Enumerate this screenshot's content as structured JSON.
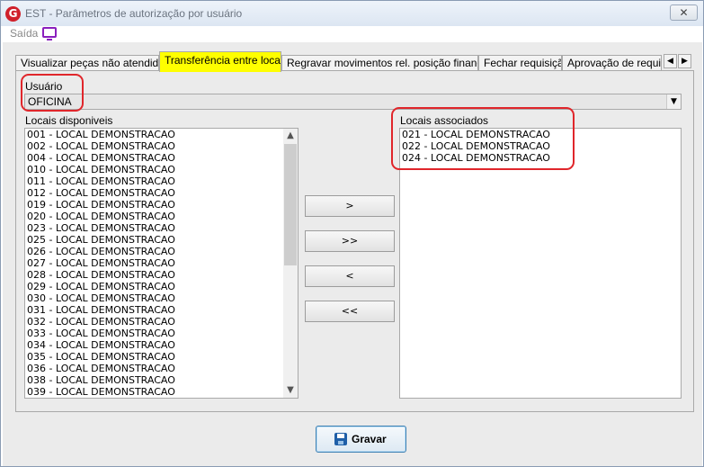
{
  "window": {
    "app_icon_letter": "G",
    "title": "EST - Parâmetros de autorização por usuário",
    "close_glyph": "✕"
  },
  "menu": {
    "saida_label": "Saída",
    "screen_icon": "monitor-icon"
  },
  "tabs": [
    {
      "label": "Visualizar peças não atendidas",
      "active": false
    },
    {
      "label": "Transferência entre locais",
      "active": true
    },
    {
      "label": "Regravar movimentos rel. posição financeira",
      "active": false
    },
    {
      "label": "Fechar requisição",
      "active": false
    },
    {
      "label": "Aprovação de requisição",
      "active": false
    }
  ],
  "tab_scroll": {
    "left": "◀",
    "right": "▶"
  },
  "usuario": {
    "label": "Usuário",
    "value": "OFICINA",
    "arrow": "▼"
  },
  "locais_disponiveis": {
    "label": "Locais disponiveis",
    "items": [
      "001 - LOCAL DEMONSTRACAO",
      "002 - LOCAL DEMONSTRACAO",
      "004 - LOCAL DEMONSTRACAO",
      "010 - LOCAL DEMONSTRACAO",
      "011 - LOCAL DEMONSTRACAO",
      "012 - LOCAL DEMONSTRACAO",
      "019 - LOCAL DEMONSTRACAO",
      "020 - LOCAL DEMONSTRACAO",
      "023 - LOCAL DEMONSTRACAO",
      "025 - LOCAL DEMONSTRACAO",
      "026 - LOCAL DEMONSTRACAO",
      "027 - LOCAL DEMONSTRACAO",
      "028 - LOCAL DEMONSTRACAO",
      "029 - LOCAL DEMONSTRACAO",
      "030 - LOCAL DEMONSTRACAO",
      "031 - LOCAL DEMONSTRACAO",
      "032 - LOCAL DEMONSTRACAO",
      "033 - LOCAL DEMONSTRACAO",
      "034 - LOCAL DEMONSTRACAO",
      "035 - LOCAL DEMONSTRACAO",
      "036 - LOCAL DEMONSTRACAO",
      "038 - LOCAL DEMONSTRACAO",
      "039 - LOCAL DEMONSTRACAO"
    ],
    "scroll_up": "▲",
    "scroll_down": "▼"
  },
  "locais_associados": {
    "label": "Locais associados",
    "items": [
      "021 - LOCAL DEMONSTRACAO",
      "022 - LOCAL DEMONSTRACAO",
      "024 - LOCAL DEMONSTRACAO"
    ]
  },
  "move_buttons": {
    "add": ">",
    "add_all": ">>",
    "remove": "<",
    "remove_all": "<<"
  },
  "save_button": {
    "label": "Gravar",
    "icon": "floppy-disk-icon"
  },
  "colors": {
    "active_tab": "#ffff00",
    "highlight": "#e0262b",
    "screen_icon": "#8a1fbd",
    "app_icon": "#d0202a"
  }
}
